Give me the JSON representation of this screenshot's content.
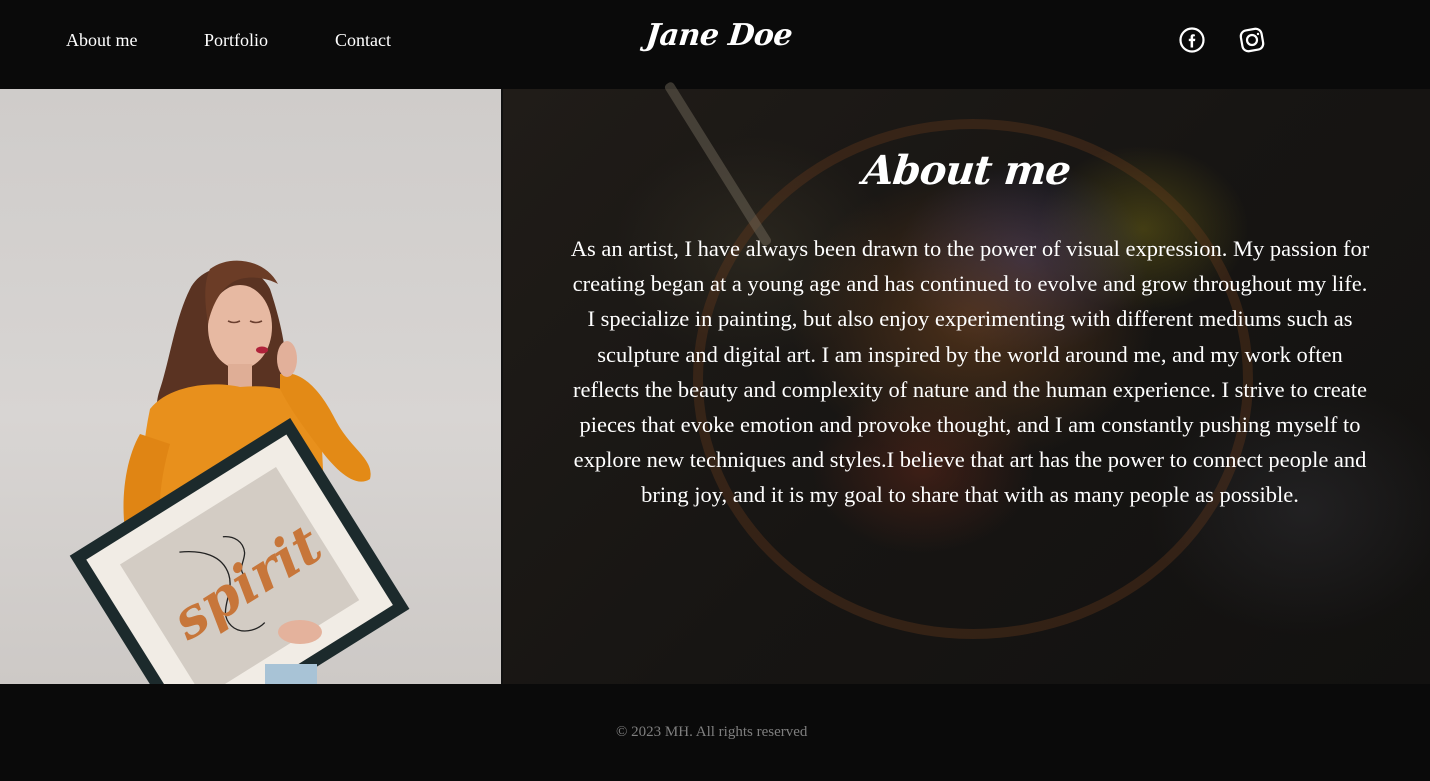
{
  "nav": {
    "about_label": "About me",
    "portfolio_label": "Portfolio",
    "contact_label": "Contact"
  },
  "brand": "Jane Doe",
  "social": {
    "icons": [
      "facebook-icon",
      "instagram-icon"
    ]
  },
  "about": {
    "title": "About me",
    "bio": "As an artist, I have always been drawn to the power of visual expression. My passion for creating began at a young age and has continued to evolve and grow throughout my life. I specialize in painting, but also enjoy experimenting with different mediums such as sculpture and digital art. I am inspired by the world around me, and my work often reflects the beauty and complexity of nature and the human experience. I strive to create pieces that evoke emotion and provoke thought, and I am constantly pushing myself to explore new techniques and styles.I believe that art has the power to connect people and bring joy, and it is my goal to share that with as many people as possible."
  },
  "photo": {
    "frame_text": "spirit"
  },
  "footer": {
    "copyright": "© 2023 MH. All rights reserved"
  },
  "colors": {
    "background": "#0a0a0a",
    "text": "#ffffff",
    "footer_text": "#7f7f7f",
    "sweater": "#e8901c"
  }
}
